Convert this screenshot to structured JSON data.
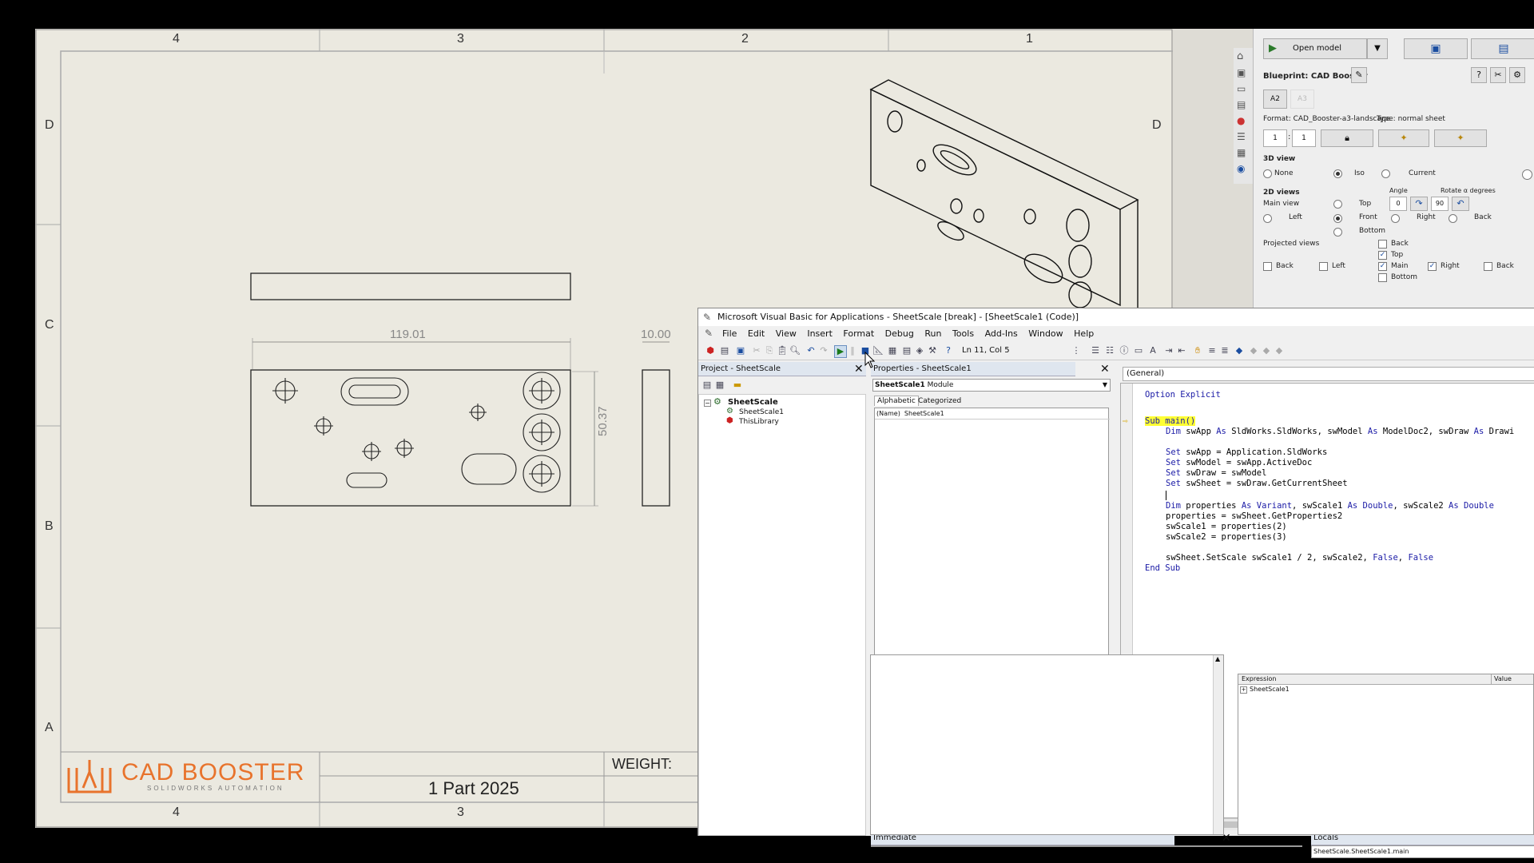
{
  "sheet": {
    "zones_top": [
      "4",
      "3",
      "2",
      "1"
    ],
    "zones_bottom": [
      "4",
      "3"
    ],
    "zones_left": [
      "D",
      "C",
      "B",
      "A"
    ],
    "zones_right": [
      "D"
    ],
    "dim_width": "119.01",
    "dim_height": "50.37",
    "dim_thickness": "10.00",
    "logo_main": "CAD BOOSTER",
    "logo_sub": "SOLIDWORKS AUTOMATION",
    "weight_label": "WEIGHT:",
    "part_label": "1 Part 2025"
  },
  "cadbooster": {
    "open_model": "Open model",
    "blueprint": "Blueprint: CAD Booster",
    "size_a2": "A2",
    "size_a3": "A3",
    "format": "Format: CAD_Booster-a3-landscape",
    "type": "Type: normal sheet",
    "scale_num": "1",
    "scale_sep": ":",
    "scale_den": "1",
    "view3d_title": "3D view",
    "v_none": "None",
    "v_iso": "Iso",
    "v_current": "Current",
    "views2d_title": "2D views",
    "main_view": "Main view",
    "angle": "Angle",
    "rotate": "Rotate α degrees",
    "angle_val": "0",
    "rotate_val": "90",
    "top": "Top",
    "front": "Front",
    "bottom": "Bottom",
    "left": "Left",
    "right": "Right",
    "back": "Back",
    "projected": "Projected views",
    "p_back": "Back",
    "p_top": "Top",
    "p_back2": "Back",
    "p_left": "Left",
    "p_main": "Main",
    "p_right": "Right",
    "p_back3": "Back",
    "p_bottom": "Bottom"
  },
  "vba": {
    "title": "Microsoft Visual Basic for Applications - SheetScale [break] - [SheetScale1 (Code)]",
    "menu": [
      "File",
      "Edit",
      "View",
      "Insert",
      "Format",
      "Debug",
      "Run",
      "Tools",
      "Add-Ins",
      "Window",
      "Help"
    ],
    "cursor_pos": "Ln 11, Col 5",
    "project_title": "Project - SheetScale",
    "tree_root": "SheetScale",
    "tree_child1": "SheetScale1",
    "tree_child2": "ThisLibrary",
    "props_title": "Properties - SheetScale1",
    "props_object": "SheetScale1",
    "props_object_type": "Module",
    "props_tab_alpha": "Alphabetic",
    "props_tab_cat": "Categorized",
    "props_row": "(Name)  SheetScale1",
    "general": "(General)",
    "code": {
      "l1_kw": "Option Explicit",
      "l2_kw": "Sub main()",
      "l3_a": "Dim",
      "l3_b": " swApp ",
      "l3_c": "As",
      "l3_d": " SldWorks.SldWorks, swModel ",
      "l3_e": "As",
      "l3_f": " ModelDoc2, swDraw ",
      "l3_g": "As",
      "l3_h": " Drawi",
      "l4_a": "Set",
      "l4_b": " swApp = Application.SldWorks",
      "l5_a": "Set",
      "l5_b": " swModel = swApp.ActiveDoc",
      "l6_a": "Set",
      "l6_b": " swDraw = swModel",
      "l7_a": "Set",
      "l7_b": " swSheet = swDraw.GetCurrentSheet",
      "l8_a": "Dim",
      "l8_b": " properties ",
      "l8_c": "As Variant",
      "l8_d": ", swScale1 ",
      "l8_e": "As Double",
      "l8_f": ", swScale2 ",
      "l8_g": "As Double",
      "l9": "properties = swSheet.GetProperties2",
      "l10": "swScale1 = properties(2)",
      "l11": "swScale2 = properties(3)",
      "l12_a": "swSheet.SetScale swScale1 / 2, swScale2, ",
      "l12_b": "False",
      "l12_c": ", ",
      "l12_d": "False",
      "l13": "End Sub"
    },
    "immediate_title": "Immediate",
    "locals_title": "Locals",
    "locals_context": "SheetScale.SheetScale1.main",
    "locals_col_expr": "Expression",
    "locals_col_value": "Value",
    "locals_row": "SheetScale1"
  }
}
